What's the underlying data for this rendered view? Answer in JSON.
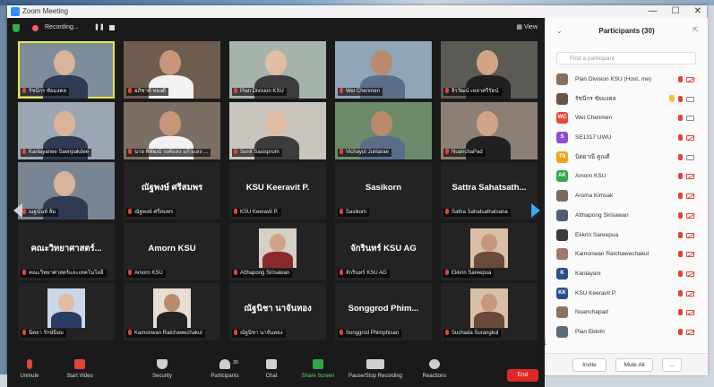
{
  "window": {
    "title": "Zoom Meeting",
    "minimize": "—",
    "maximize": "☐",
    "close": "✕"
  },
  "topbar": {
    "recording_label": "Recording...",
    "pause_icon": "❚❚",
    "view_label": "▦ View"
  },
  "tiles": [
    {
      "label": "รัชนีกร ชัยมงคล",
      "kind": "video",
      "active": true
    },
    {
      "label": "อภิชาติ ทองดี",
      "kind": "video"
    },
    {
      "label": "Plan Division KSU",
      "kind": "video"
    },
    {
      "label": "Wei Chenmen",
      "kind": "video"
    },
    {
      "label": "จิรวัฒน์ เหล่าศรีรัตน์",
      "kind": "video"
    },
    {
      "label": "Kanlayanee Saenpakdee",
      "kind": "video"
    },
    {
      "label": "นาย พิพัฒน์ วงค์แสง แก้วแสง ...",
      "kind": "video"
    },
    {
      "label": "Sunit Sasisprom",
      "kind": "video"
    },
    {
      "label": "Vichayut Juntarae",
      "kind": "video"
    },
    {
      "label": "NuanchaPad",
      "kind": "video"
    },
    {
      "label": "ณฐนันท์ ลิ้ม",
      "kind": "video"
    },
    {
      "label": "ณัฐพงษ์ ศรีสมพร",
      "bigname": "ณัฐพงษ์ ศรีสมพร",
      "kind": "name"
    },
    {
      "label": "KSU Keeravit P.",
      "bigname": "KSU Keeravit P.",
      "kind": "name"
    },
    {
      "label": "Sasikorn",
      "bigname": "Sasikorn",
      "kind": "name"
    },
    {
      "label": "Sattra Sahatsathatsana",
      "bigname": "Sattra Sahatsath...",
      "kind": "name"
    },
    {
      "label": "คณะวิทยาศาสตร์และเทคโนโลยี",
      "bigname": "คณะวิทยาศาสตร์...",
      "kind": "name"
    },
    {
      "label": "Amorn KSU",
      "bigname": "Amorn KSU",
      "kind": "name"
    },
    {
      "label": "Atthapong Sirisawan",
      "kind": "avatar"
    },
    {
      "label": "จักรินทร์ KSU AG",
      "bigname": "จักรินทร์ KSU AG",
      "kind": "name"
    },
    {
      "label": "Ekkrin Sareepua",
      "kind": "avatar"
    },
    {
      "label": "นิตยา รักษ์นิยม",
      "kind": "avatar"
    },
    {
      "label": "Kamonwan Ratchawechakul",
      "kind": "avatar"
    },
    {
      "label": "ณัฐนิชา นาจันทอง",
      "bigname": "ณัฐนิชา นาจันทอง",
      "kind": "name"
    },
    {
      "label": "Songgrod Phimphisan",
      "bigname": "Songgrod Phim...",
      "kind": "name"
    },
    {
      "label": "Suchada Surangkul",
      "kind": "avatar"
    }
  ],
  "toolbar": {
    "unmute": "Unmute",
    "start_video": "Start Video",
    "security": "Security",
    "participants": "Participants",
    "participants_count": "30",
    "chat": "Chat",
    "share_screen": "Share Screen",
    "pause_recording": "Pause/Stop Recording",
    "reactions": "Reactions",
    "end": "End"
  },
  "panel": {
    "title": "Participants (30)",
    "search_placeholder": "Find a participant",
    "invite": "Invite",
    "mute_all": "Mute All",
    "more": "...",
    "participants": [
      {
        "name": "Plan Division KSU (Host, me)",
        "initials": "",
        "color": "#8a6d5a",
        "cam": "off",
        "hand": false
      },
      {
        "name": "รัชนีกร ชัยมงคล",
        "initials": "",
        "color": "#6a5447",
        "cam": "on",
        "hand": true
      },
      {
        "name": "Wei Chenmen",
        "initials": "WC",
        "color": "#e8483a",
        "cam": "on",
        "hand": false
      },
      {
        "name": "SE1317 UWU",
        "initials": "S",
        "color": "#8d4cd6",
        "cam": "off",
        "hand": false
      },
      {
        "name": "นิตยาณี คูณดี",
        "initials": "TN",
        "color": "#f0a419",
        "cam": "on",
        "hand": false
      },
      {
        "name": "Amorn KSU",
        "initials": "AK",
        "color": "#32a84f",
        "cam": "off",
        "hand": false
      },
      {
        "name": "Aroma Kimsak",
        "initials": "",
        "color": "#7a6a60",
        "cam": "off",
        "hand": false
      },
      {
        "name": "Atthapong Sirisawan",
        "initials": "",
        "color": "#4f5e75",
        "cam": "off",
        "hand": false
      },
      {
        "name": "Ekkrin Sareepua",
        "initials": "",
        "color": "#3b3b3b",
        "cam": "off",
        "hand": false
      },
      {
        "name": "Kamonwan Ratchawechakul",
        "initials": "",
        "color": "#9b7c6a",
        "cam": "off",
        "hand": false
      },
      {
        "name": "Kanlayani",
        "initials": "K",
        "color": "#2c4e8a",
        "cam": "off",
        "hand": false
      },
      {
        "name": "KSU Keeravit P.",
        "initials": "KK",
        "color": "#2c4e8a",
        "cam": "off",
        "hand": false
      },
      {
        "name": "Nuanchapad",
        "initials": "",
        "color": "#8a7262",
        "cam": "off",
        "hand": false
      },
      {
        "name": "Plan Ekkrin",
        "initials": "",
        "color": "#5d6b78",
        "cam": "off",
        "hand": false
      }
    ]
  },
  "reaction_count": "1"
}
